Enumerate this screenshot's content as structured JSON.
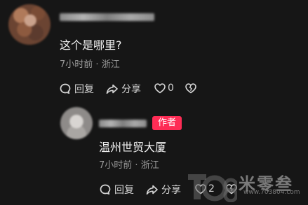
{
  "comment": {
    "text": "这个是哪里?",
    "time": "7小时前",
    "separator": "·",
    "location": "浙江",
    "actions": {
      "reply_label": "回复",
      "share_label": "分享",
      "like_count": "0"
    }
  },
  "reply": {
    "author_badge": "作者",
    "text": "温州世贸大厦",
    "time": "7小时前",
    "separator": "·",
    "location": "浙江",
    "actions": {
      "reply_label": "回复",
      "share_label": "分享",
      "like_count": "2"
    }
  },
  "watermark": {
    "brand": "米零叁",
    "url": "www.703804.com"
  },
  "colors": {
    "background": "#161616",
    "author_badge": "#fe2c55",
    "muted_text": "#9a9a9a"
  },
  "icons": [
    "speech-bubble-icon",
    "share-arrow-icon",
    "heart-icon",
    "broken-heart-icon"
  ]
}
